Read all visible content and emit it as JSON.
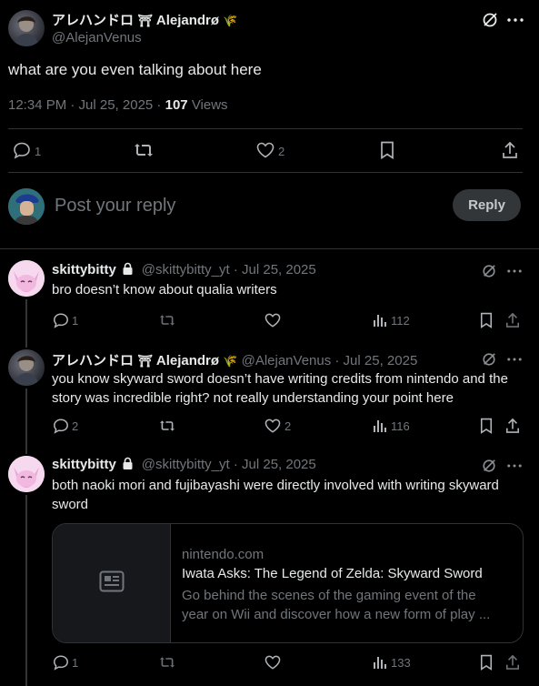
{
  "main_post": {
    "author_name": "アレハンドロ ⚠ Alejandrø 🌾",
    "author_name_text": "アレハンドロ",
    "author_name_latin": "Alejandrø",
    "handle": "@AlejanVenus",
    "text": "what are you even talking about here",
    "time": "12:34 PM · Jul 25, 2025 ·",
    "views_count": "107",
    "views_label": "Views",
    "replies": "1",
    "likes": "2"
  },
  "reply_box": {
    "placeholder": "Post your reply",
    "button_label": "Reply"
  },
  "replies": [
    {
      "name": "skittybitty",
      "handle": "@skittybitty_yt · Jul 25, 2025",
      "text": "bro doesn’t know about qualia writers",
      "replies": "1",
      "likes": "",
      "views": "112"
    },
    {
      "name_jp": "アレハンドロ",
      "name_latin": "Alejandrø",
      "handle": "@AlejanVenus · Jul 25, 2025",
      "text": "you know skyward sword doesn’t have writing credits from nintendo and the story was incredible right? not really understanding your point here",
      "replies": "2",
      "likes": "2",
      "views": "116"
    },
    {
      "name": "skittybitty",
      "handle": "@skittybitty_yt · Jul 25, 2025",
      "text": "both naoki mori and fujibayashi were directly involved with writing skyward sword",
      "replies": "1",
      "likes": "",
      "views": "133",
      "card": {
        "domain": "nintendo.com",
        "title": "Iwata Asks: The Legend of Zelda: Skyward Sword",
        "desc_line1": "Go behind the scenes of the gaming event of the",
        "desc_line2": "year on Wii and discover how a new form of play ..."
      }
    }
  ],
  "colors": {
    "background": "#000000",
    "text": "#e7e9ea",
    "muted": "#71767b",
    "divider": "#2f3336",
    "verified_gold": "#d9b44a"
  }
}
